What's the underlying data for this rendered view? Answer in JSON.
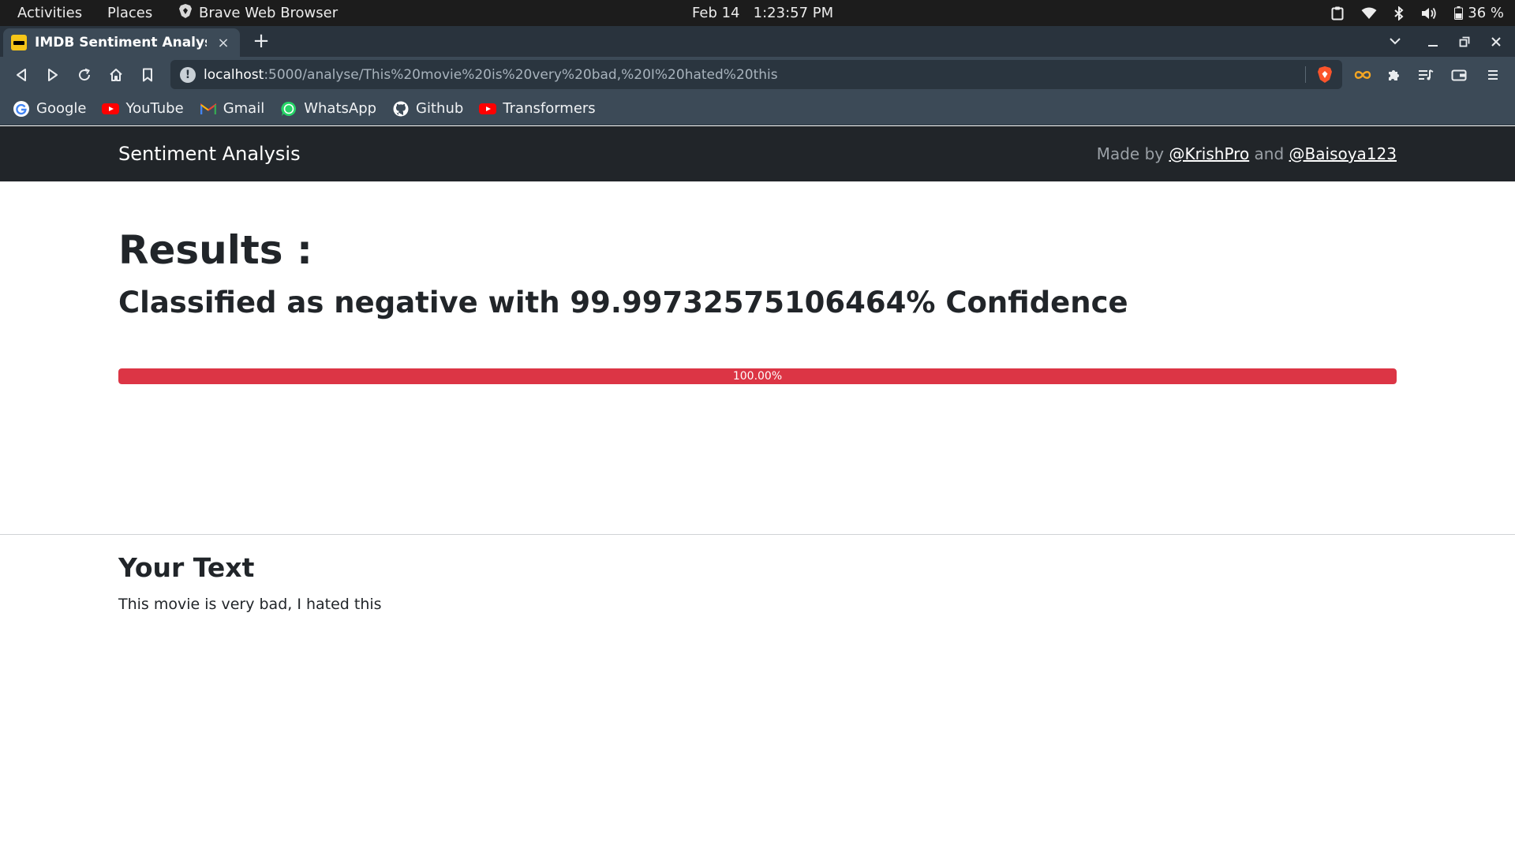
{
  "topbar": {
    "activities": "Activities",
    "places": "Places",
    "app_name": "Brave Web Browser",
    "datetime": "Feb 14   1:23:57 PM",
    "battery": "36 %"
  },
  "browser": {
    "tab_title": "IMDB Sentiment Analysis",
    "tab_close": "×",
    "new_tab": "+",
    "url_host": "localhost",
    "url_rest": ":5000/analyse/This%20movie%20is%20very%20bad,%20I%20hated%20this",
    "info_glyph": "!"
  },
  "bookmarks": [
    {
      "label": "Google",
      "icon": "google-icon"
    },
    {
      "label": "YouTube",
      "icon": "youtube-icon"
    },
    {
      "label": "Gmail",
      "icon": "gmail-icon"
    },
    {
      "label": "WhatsApp",
      "icon": "whatsapp-icon"
    },
    {
      "label": "Github",
      "icon": "github-icon"
    },
    {
      "label": "Transformers",
      "icon": "youtube-icon"
    }
  ],
  "site": {
    "brand": "Sentiment Analysis",
    "made_by": "Made by ",
    "author1": "@KrishPro",
    "and": " and ",
    "author2": "@Baisoya123"
  },
  "results": {
    "heading": "Results :",
    "classified_prefix": "Classified as ",
    "label": "negative",
    "classified_suffix": " with 99.99732575106464% Confidence",
    "progress_text": "100.00%",
    "progress_value": 100
  },
  "input": {
    "heading": "Your Text",
    "text": "This movie is very bad, I hated this"
  },
  "colors": {
    "negative": "#dc3545",
    "navbar": "#212529",
    "browser_chrome": "#3c4a57"
  }
}
